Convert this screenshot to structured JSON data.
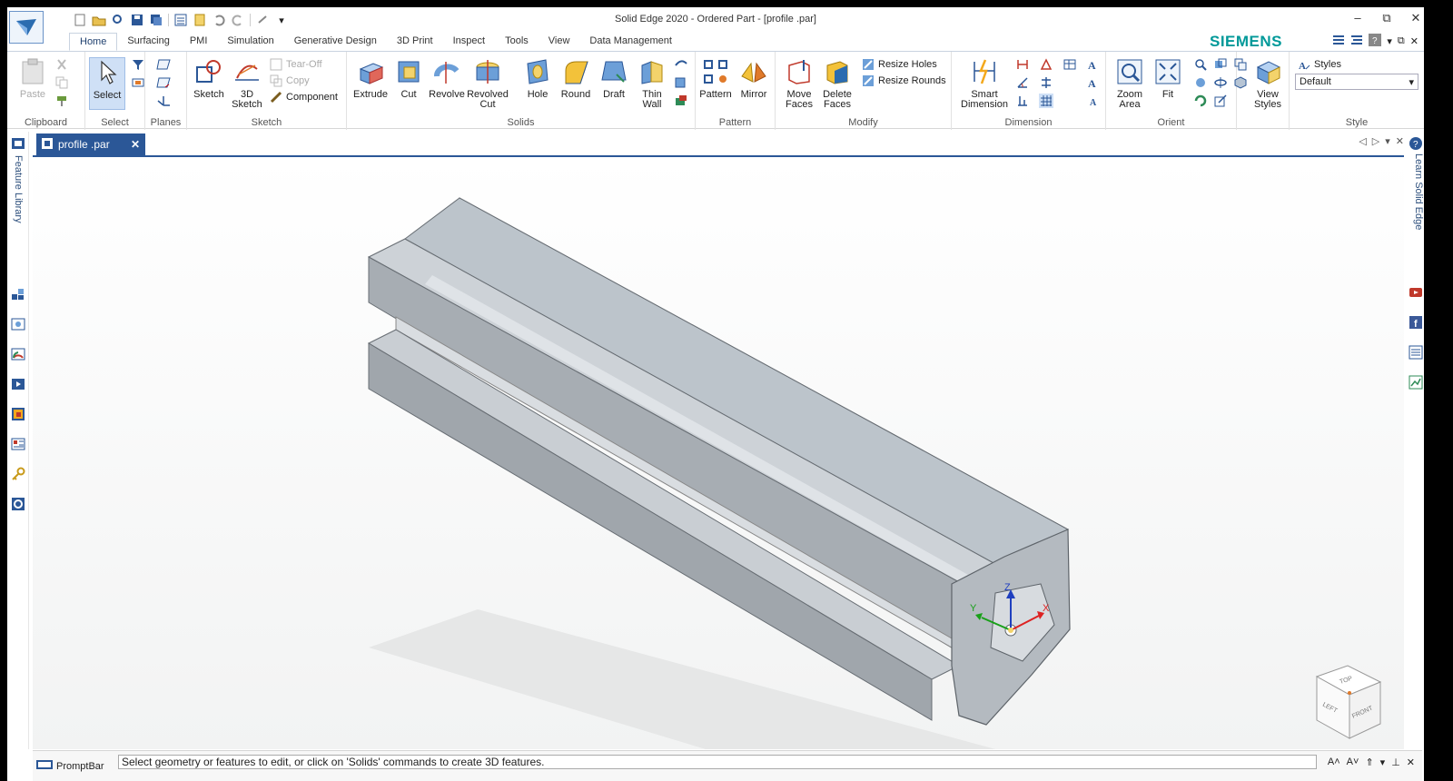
{
  "window": {
    "title": "Solid Edge 2020 - Ordered Part - [profile .par]",
    "controls": [
      "–",
      "⧉",
      "✕"
    ]
  },
  "colors": {
    "accent": "#2b5797",
    "brand": "#009999",
    "selection": "#cfe0f6"
  },
  "tabs": [
    {
      "label": "Home",
      "active": true
    },
    {
      "label": "Surfacing"
    },
    {
      "label": "PMI"
    },
    {
      "label": "Simulation"
    },
    {
      "label": "Generative Design"
    },
    {
      "label": "3D Print"
    },
    {
      "label": "Inspect"
    },
    {
      "label": "Tools"
    },
    {
      "label": "View"
    },
    {
      "label": "Data Management"
    }
  ],
  "brand": "SIEMENS",
  "ribbon": {
    "clipboard": {
      "label": "Clipboard",
      "paste": "Paste"
    },
    "select": {
      "label": "Select",
      "select_btn": "Select"
    },
    "planes": {
      "label": "Planes"
    },
    "sketch": {
      "label": "Sketch",
      "sketch_btn": "Sketch",
      "sketch3d": "3D Sketch",
      "tear_off": "Tear-Off",
      "copy": "Copy",
      "component": "Component"
    },
    "solids": {
      "label": "Solids",
      "extrude": "Extrude",
      "cut": "Cut",
      "revolve": "Revolve",
      "revolved_cut": "Revolved Cut",
      "hole": "Hole",
      "round": "Round",
      "draft": "Draft",
      "thin_wall": "Thin Wall"
    },
    "pattern": {
      "label": "Pattern",
      "pattern_btn": "Pattern",
      "mirror": "Mirror"
    },
    "modify": {
      "label": "Modify",
      "move_faces": "Move Faces",
      "delete_faces": "Delete Faces",
      "resize_holes": "Resize Holes",
      "resize_rounds": "Resize Rounds"
    },
    "dimension": {
      "label": "Dimension",
      "smart_dimension": "Smart Dimension"
    },
    "orient": {
      "label": "Orient",
      "zoom_area": "Zoom Area",
      "fit": "Fit"
    },
    "view_styles": {
      "label": "View Styles"
    },
    "style": {
      "label": "Style",
      "styles": "Styles",
      "selected": "Default"
    }
  },
  "left_panel": {
    "label": "Feature Library"
  },
  "right_panel": {
    "label": "Learn Solid Edge"
  },
  "document_tab": {
    "name": "profile .par"
  },
  "view_cube": {
    "top": "TOP",
    "left": "LEFT",
    "front": "FRONT"
  },
  "triad": {
    "x": "X",
    "y": "Y",
    "z": "Z"
  },
  "prompt": {
    "label": "PromptBar",
    "text": "Select geometry or features to edit, or click on 'Solids' commands to create 3D features."
  }
}
